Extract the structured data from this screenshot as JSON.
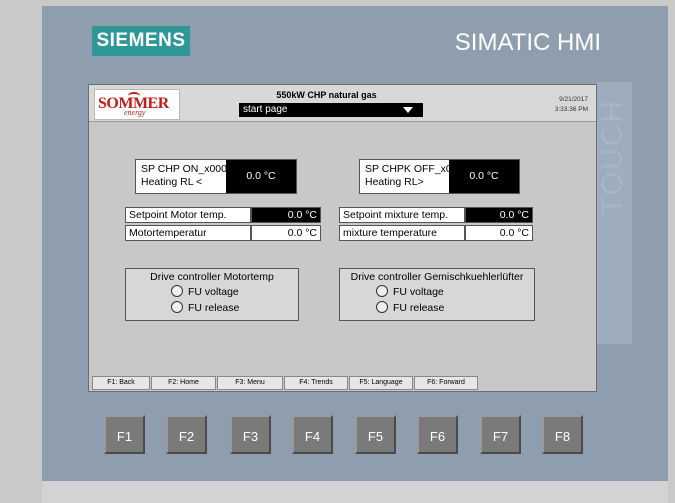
{
  "panel": {
    "brand": "SIEMENS",
    "product": "SIMATIC HMI",
    "touch_label": "TOUCH"
  },
  "header": {
    "logo_text": "SOMMER",
    "logo_sub": "energy",
    "title": "550kW CHP natural gas",
    "page_select": "start page",
    "date": "9/21/2017",
    "time": "3:33:36 PM"
  },
  "setpoints": {
    "sp_on": {
      "label_line1": "SP CHP ON_x000",
      "label_line2": "Heating RL <",
      "value": "0.0 °C"
    },
    "sp_off": {
      "label_line1": "SP CHPK OFF_x0",
      "label_line2": "Heating RL>",
      "value": "0.0 °C"
    }
  },
  "rows": {
    "setpoint_motor": {
      "label": "Setpoint Motor temp.",
      "value": "0.0 °C"
    },
    "motor_temp": {
      "label": "Motortemperatur",
      "value": "0.0 °C"
    },
    "setpoint_mixture": {
      "label": "Setpoint mixture temp.",
      "value": "0.0 °C"
    },
    "mixture_temp": {
      "label": "mixture temperature",
      "value": "0.0 °C"
    }
  },
  "groups": {
    "motor": {
      "title": "Drive controller Motortemp",
      "opt1": "FU voltage",
      "opt2": "FU release"
    },
    "mixture": {
      "title": "Drive controller Gemischkuehlerlüfter",
      "opt1": "FU voltage",
      "opt2": "FU release"
    }
  },
  "function_bar": [
    "F1: Back",
    "F2: Home",
    "F3: Menu",
    "F4: Trends",
    "F5: Language",
    "F6: Forward"
  ],
  "keys": [
    "F1",
    "F2",
    "F3",
    "F4",
    "F5",
    "F6",
    "F7",
    "F8"
  ],
  "colors": {
    "bezel": "#8e9eaf",
    "brand_teal": "#2e9797",
    "screen_bg": "#c8c8c8",
    "logo_red": "#c41a1a",
    "key_gray": "#7a7a7a"
  }
}
